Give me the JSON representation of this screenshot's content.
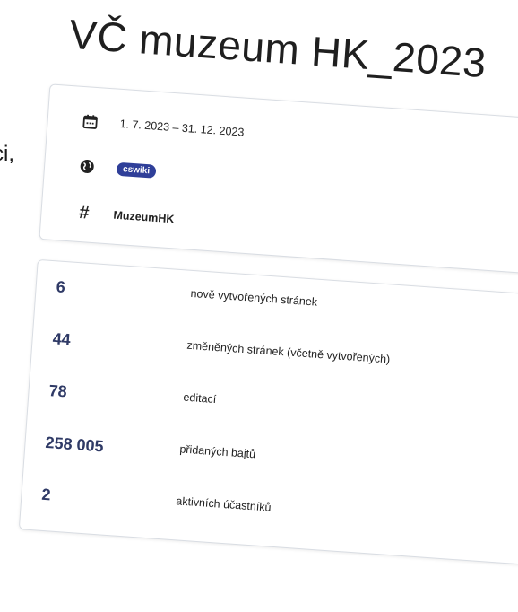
{
  "edge_text": "ci,",
  "title": "VČ muzeum HK_2023",
  "meta": {
    "date_range": "1. 7. 2023 – 31. 12. 2023",
    "wiki_badge": "cswiki",
    "hashtag": "MuzeumHK"
  },
  "stats": [
    {
      "value": "6",
      "label": "nově vytvořených stránek"
    },
    {
      "value": "44",
      "label": "změněných stránek (včetně vytvořených)"
    },
    {
      "value": "78",
      "label": "editací"
    },
    {
      "value": "258 005",
      "label": "přidaných bajtů"
    },
    {
      "value": "2",
      "label": "aktivních účastníků"
    }
  ],
  "colors": {
    "badge_bg": "#2f3f99",
    "stat_number": "#2f3a66"
  },
  "icons": [
    "calendar-icon",
    "globe-icon",
    "hash-icon"
  ]
}
